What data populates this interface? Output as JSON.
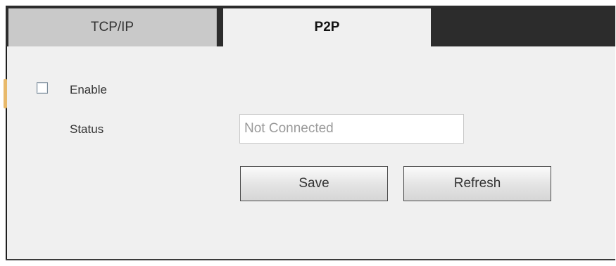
{
  "tabs": [
    {
      "label": "TCP/IP",
      "active": false
    },
    {
      "label": "P2P",
      "active": true
    }
  ],
  "form": {
    "enable": {
      "label": "Enable",
      "checked": false
    },
    "status": {
      "label": "Status",
      "value": "Not Connected"
    }
  },
  "buttons": {
    "save_label": "Save",
    "refresh_label": "Refresh"
  },
  "colors": {
    "tabbar_background": "#2c2c2c",
    "inactive_tab": "#c9c9c9",
    "panel_background": "#f0f0f0"
  }
}
